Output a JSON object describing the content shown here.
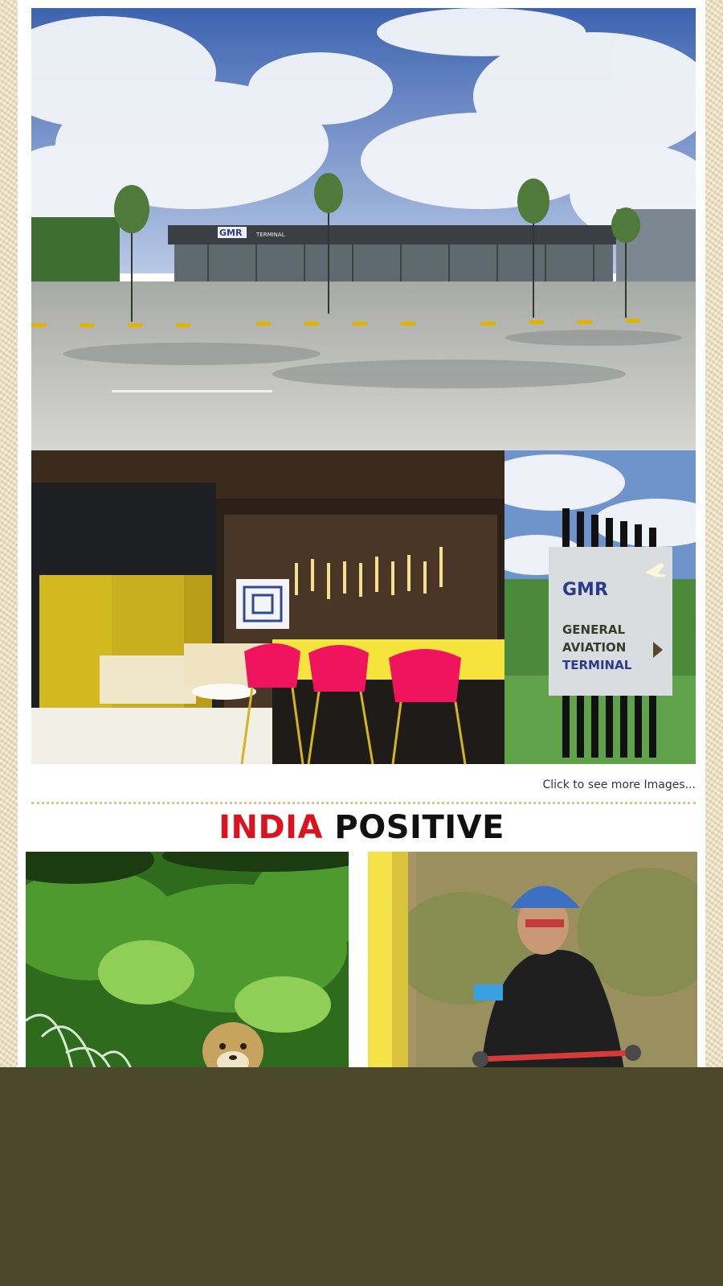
{
  "gallery": {
    "hero": {
      "alt": "GMR General Aviation Terminal building exterior",
      "building_logo": "GMR",
      "building_sign": "TERMINAL"
    },
    "lounge": {
      "alt": "Terminal lounge with pink bar stools"
    },
    "signboard": {
      "alt": "General Aviation Terminal sign",
      "logo": "GMR",
      "line1": "GENERAL",
      "line2": "AVIATION",
      "line3": "TERMINAL"
    },
    "more_link": "Click to see more Images..."
  },
  "section": {
    "title_accent": "INDIA",
    "title_rest": " POSITIVE"
  },
  "stories": [
    {
      "alt": "Cheetah peeking through grass"
    },
    {
      "alt": "Woman cyclist wearing a blue helmet"
    }
  ],
  "colors": {
    "accent": "#d9131f",
    "overlay": "#4c472a",
    "divider": "#d7c29a"
  }
}
